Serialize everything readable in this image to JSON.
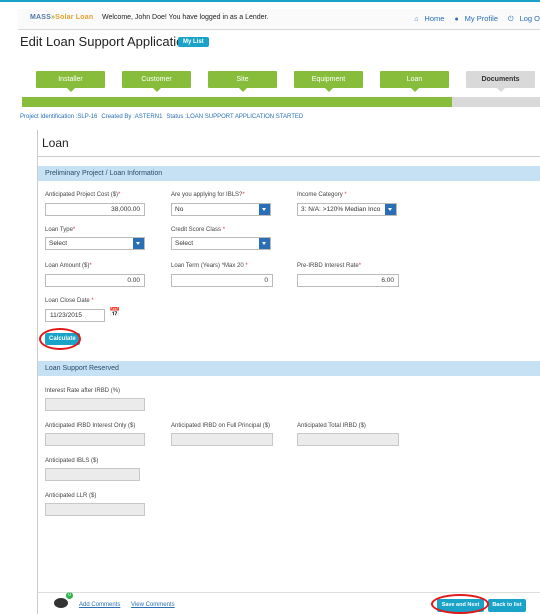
{
  "header": {
    "logo": {
      "mass": "MASS",
      "sep": "»",
      "solar": "Solar Loan"
    },
    "welcome": "Welcome, John Doe! You have logged in as a Lender.",
    "links": {
      "home": "Home",
      "profile": "My Profile",
      "logout": "Log O"
    },
    "icons": {
      "home": "home-icon",
      "profile": "user-icon",
      "logout": "power-icon"
    }
  },
  "page": {
    "title": "Edit Loan Support Application",
    "mylist": "My List"
  },
  "steps": [
    {
      "label": "Installer",
      "state": "complete"
    },
    {
      "label": "Customer",
      "state": "complete"
    },
    {
      "label": "Site",
      "state": "complete"
    },
    {
      "label": "Equipment",
      "state": "complete"
    },
    {
      "label": "Loan",
      "state": "complete"
    },
    {
      "label": "Documents",
      "state": "pending"
    }
  ],
  "progress": {
    "fraction": 0.83
  },
  "project": {
    "id": "Project Identification :SLP-16",
    "created": "Created By :ASTERN1",
    "status": "Status :LOAN SUPPORT APPLICATION STARTED"
  },
  "loan": {
    "section_title": "Loan",
    "prelim_title": "Preliminary Project / Loan Information",
    "cost_label": "Anticipated Project Cost ($)",
    "cost_value": "38,000.00",
    "ibls_label": "Are you applying for IBLS?",
    "ibls_value": "No",
    "income_label": "Income Category ",
    "income_value": "3: N/A: >120% Median Inco",
    "type_label": "Loan Type",
    "type_value": "Select",
    "credit_label": "Credit Score Class ",
    "credit_value": "Select",
    "amount_label": "Loan Amount ($)",
    "amount_value": "0.00",
    "term_label": "Loan Term (Years) *Max 20 ",
    "term_value": "0",
    "rate_label": "Pre-IRBD Interest Rate",
    "rate_value": "6.00",
    "close_label": "Loan Close Date ",
    "close_value": "11/23/2015",
    "required_mark": "*",
    "calculate": "Calculate"
  },
  "reserved": {
    "title": "Loan Support Reserved",
    "rate_after": "Interest Rate after IRBD (%)",
    "irbd_interest": "Anticipated IRBD Interest Only ($)",
    "irbd_principal": "Anticipated IRBD on Full Principal ($)",
    "total_irbd": "Anticipated Total IRBD ($)",
    "ibls": "Anticipated IBLS ($)",
    "llr": "Anticipated LLR ($)"
  },
  "footer": {
    "comment_count": "0",
    "add_comments": "Add Comments",
    "view_comments": "View Comments",
    "save_next": "Save and Next",
    "back": "Back to list"
  },
  "colors": {
    "accent": "#1aa3c9",
    "step_green": "#88bd3b",
    "step_grey": "#d9d9d9",
    "link": "#2a6fb5",
    "section_bar": "#c6e1f3",
    "highlight": "#e01818"
  }
}
